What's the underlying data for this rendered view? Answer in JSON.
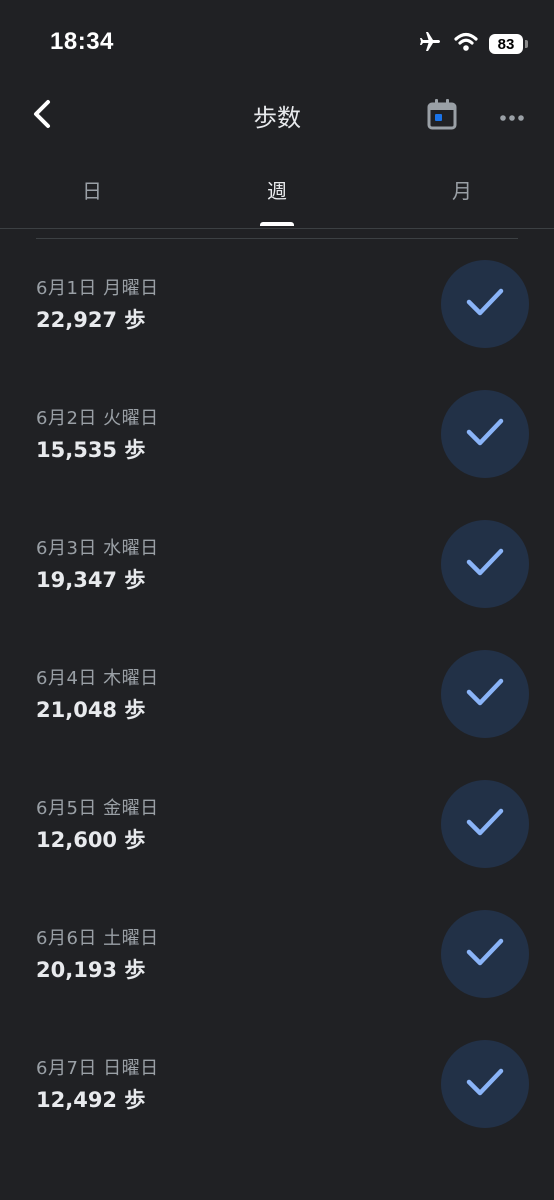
{
  "status_bar": {
    "time": "18:34",
    "icons": [
      "airplane-icon",
      "wifi-icon",
      "battery-icon"
    ],
    "battery_level": "83"
  },
  "app_bar": {
    "title": "歩数",
    "back_icon": "chevron-left-icon",
    "calendar_icon": "calendar-icon",
    "more_icon": "more-horizontal-icon"
  },
  "tabs": [
    {
      "label": "日",
      "active": false
    },
    {
      "label": "週",
      "active": true
    },
    {
      "label": "月",
      "active": false
    }
  ],
  "colors": {
    "background": "#202124",
    "check_circle": "#223147",
    "check_mark": "#8ab4f8",
    "accent_dot": "#1a73e8"
  },
  "days": [
    {
      "date": "6月1日 月曜日",
      "steps": "22,927 歩",
      "goal_met": true
    },
    {
      "date": "6月2日 火曜日",
      "steps": "15,535 歩",
      "goal_met": true
    },
    {
      "date": "6月3日 水曜日",
      "steps": "19,347 歩",
      "goal_met": true
    },
    {
      "date": "6月4日 木曜日",
      "steps": "21,048 歩",
      "goal_met": true
    },
    {
      "date": "6月5日 金曜日",
      "steps": "12,600 歩",
      "goal_met": true
    },
    {
      "date": "6月6日 土曜日",
      "steps": "20,193 歩",
      "goal_met": true
    },
    {
      "date": "6月7日 日曜日",
      "steps": "12,492 歩",
      "goal_met": true
    }
  ]
}
